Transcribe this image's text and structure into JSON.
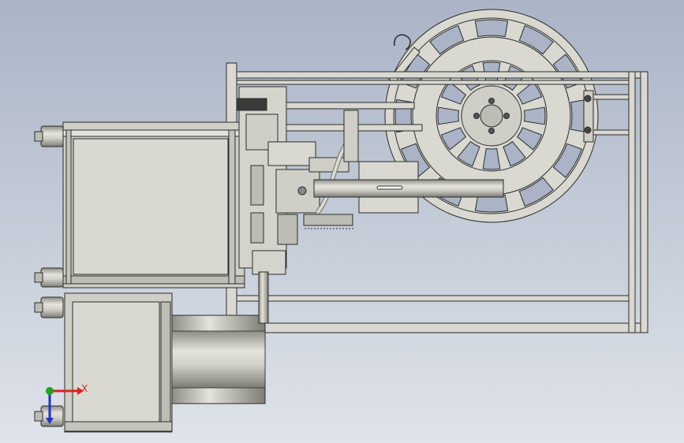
{
  "viewport": {
    "background_top": "#aab4c6",
    "background_bottom": "#dfe3ea"
  },
  "colors": {
    "part_fill": "#d9d9d2",
    "part_fill_dark": "#b9b9b1",
    "edge": "#2b2b2b",
    "axis_x": "#e02020",
    "axis_y": "#20a020",
    "axis_z": "#2030d0"
  },
  "triad": {
    "x_label": "X"
  }
}
